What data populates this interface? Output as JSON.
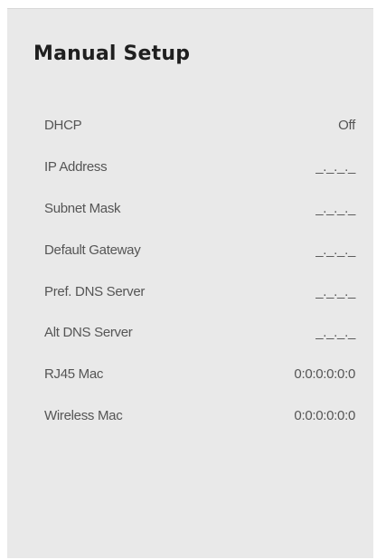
{
  "header": {
    "title": "Manual Setup"
  },
  "settings": {
    "rows": [
      {
        "label": "DHCP",
        "value": "Off"
      },
      {
        "label": "IP Address",
        "value": "_._._._"
      },
      {
        "label": "Subnet Mask",
        "value": "_._._._"
      },
      {
        "label": "Default Gateway",
        "value": "_._._._"
      },
      {
        "label": "Pref. DNS Server",
        "value": "_._._._"
      },
      {
        "label": "Alt DNS Server",
        "value": "_._._._"
      },
      {
        "label": "RJ45 Mac",
        "value": "0:0:0:0:0:0"
      },
      {
        "label": "Wireless Mac",
        "value": "0:0:0:0:0:0"
      }
    ]
  }
}
